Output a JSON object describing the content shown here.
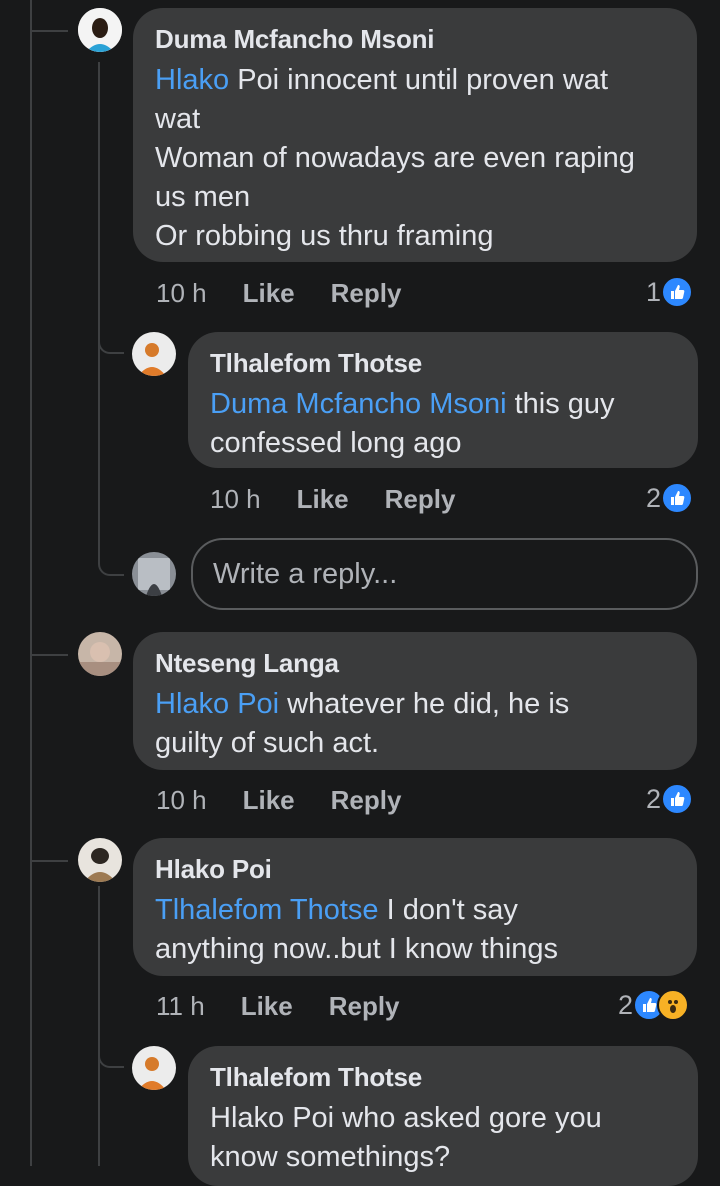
{
  "comments": [
    {
      "author": "Duma Mcfancho Msoni",
      "mention": "Hlako",
      "text_line1": " Poi innocent until proven wat",
      "text_line2": "wat",
      "text_line3": "Woman of nowadays are even raping",
      "text_line4": "us men",
      "text_line5": "Or robbing us thru framing",
      "time": "10 h",
      "like": "Like",
      "reply": "Reply",
      "reaction_count": "1"
    },
    {
      "author": "Tlhalefom Thotse",
      "mention": "Duma Mcfancho Msoni",
      "text_line1": " this guy",
      "text_line2": "confessed long ago",
      "time": "10 h",
      "like": "Like",
      "reply": "Reply",
      "reaction_count": "2"
    },
    {
      "author": "Nteseng Langa",
      "mention": "Hlako Poi",
      "text_line1": " whatever he did, he is",
      "text_line2": "guilty of such act.",
      "time": "10 h",
      "like": "Like",
      "reply": "Reply",
      "reaction_count": "2"
    },
    {
      "author": "Hlako Poi",
      "mention": "Tlhalefom Thotse",
      "text_line1": " I don't say",
      "text_line2": "anything now..but I know things",
      "time": "11 h",
      "like": "Like",
      "reply": "Reply",
      "reaction_count": "2"
    },
    {
      "author": "Tlhalefom Thotse",
      "text_line1": "Hlako Poi who asked gore you",
      "text_line2": "know somethings?"
    }
  ],
  "reply_box": {
    "placeholder": "Write a reply..."
  },
  "colors": {
    "background": "#18191a",
    "bubble": "#3a3b3c",
    "mention": "#4a9ff5",
    "like": "#2d88ff"
  },
  "icons": {
    "like": "thumbs-up-icon",
    "wow": "wow-face-icon"
  }
}
